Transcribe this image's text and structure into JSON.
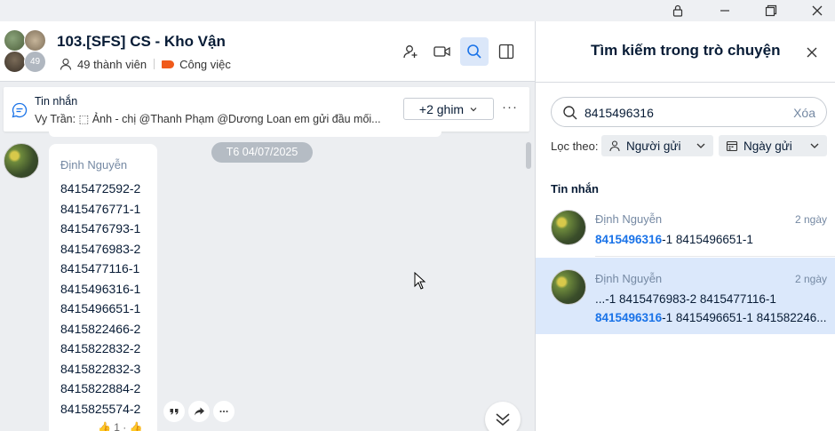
{
  "titlebar": {
    "icons": [
      "lock-icon",
      "minimize-icon",
      "restore-icon",
      "close-icon"
    ]
  },
  "chat": {
    "title": "103.[SFS] CS - Kho Vận",
    "avatar_count": "49",
    "members": "49 thành viên",
    "label": "Công việc",
    "pinned": {
      "title": "Tin nhắn",
      "text": "Vy Trần: ⬚ Ảnh - chị @Thanh Phạm @Dương Loan em gửi đầu mối...",
      "ghim_label": "+2 ghim",
      "more": "···"
    },
    "date_chip": "T6 04/07/2025",
    "message": {
      "sender": "Định Nguyễn",
      "lines": [
        "8415472592-2",
        "8415476771-1",
        "8415476793-1",
        "8415476983-2",
        "8415477116-1",
        "8415496316-1",
        "8415496651-1",
        "8415822466-2",
        "8415822832-2",
        "8415822832-3",
        "8415822884-2",
        "8415825574-2"
      ],
      "reaction": "👍 1 · 👍"
    }
  },
  "search": {
    "title": "Tìm kiếm trong trò chuyện",
    "query": "8415496316",
    "clear_label": "Xóa",
    "filter_label": "Lọc theo:",
    "filter_sender": "Người gửi",
    "filter_date": "Ngày gửi",
    "section": "Tin nhắn",
    "results": [
      {
        "name": "Định Nguyễn",
        "time": "2 ngày",
        "line1_hl": "8415496316",
        "line1_rest": "-1 8415496651-1"
      },
      {
        "name": "Định Nguyễn",
        "time": "2 ngày",
        "line1": "...-1 8415476983-2 8415477116-1",
        "line2_hl": "8415496316",
        "line2_rest": "-1 8415496651-1 841582246..."
      }
    ]
  },
  "colors": {
    "accent": "#1a73e8",
    "selected_bg": "#dbe8fb",
    "tag": "#f05a1a"
  }
}
